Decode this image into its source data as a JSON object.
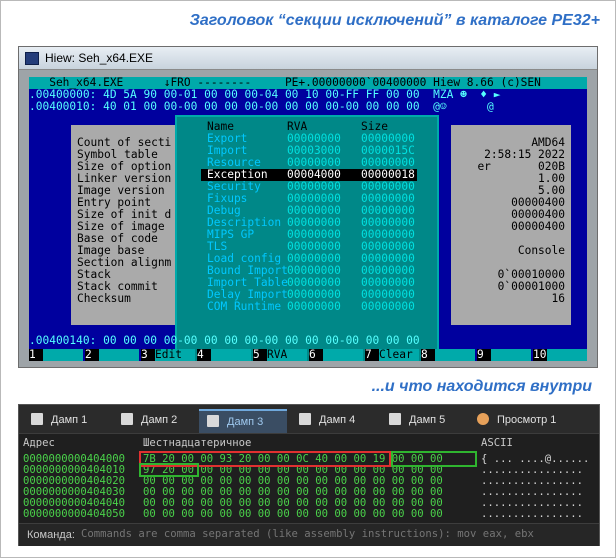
{
  "captions": {
    "top": "Заголовок “секции исключений” в каталоге PE32+",
    "bottom": "...и что находится внутри"
  },
  "hiew": {
    "window_title": "Hiew: Seh_x64.EXE",
    "status_line": "   Seh_x64.EXE      ↓FRO --------     PE+.00000000`00400000 Hiew 8.66 (c)SEN",
    "line1": ".00400000: 4D 5A 90 00-01 00 00 00-04 00 10 00-FF FF 00 00  MZA ☻  ♦ ►",
    "line2": ".00400010: 40 01 00 00-00 00 00 00-00 00 00 00-00 00 00 00  @☺      @",
    "bottom_line": ".00400140: 00 00 00 00-00 00 00 00-00 00 00 00-00 00 00 00",
    "info_labels": [
      "Count of secti",
      "Symbol table",
      "Size of option",
      "Linker version",
      "Image version",
      "Entry point",
      "Size of init d",
      "Size of image",
      "Base of code",
      "Image base",
      "Section alignm",
      "Stack",
      "Stack commit",
      "Checksum"
    ],
    "info_values": [
      "AMD64",
      "2:58:15 2022",
      "er       020B",
      "1.00",
      "5.00",
      "00000400",
      "00000400",
      "00000400",
      "",
      "Console",
      "",
      "0`00010000",
      "0`00001000",
      "16"
    ],
    "dir_header": {
      "name": "Name",
      "rva": "RVA",
      "size": "Size"
    },
    "dir_rows": [
      {
        "name": "Export",
        "rva": "00000000",
        "size": "00000000"
      },
      {
        "name": "Import",
        "rva": "00003000",
        "size": "0000015C"
      },
      {
        "name": "Resource",
        "rva": "00000000",
        "size": "00000000"
      },
      {
        "name": "Exception",
        "rva": "00004000",
        "size": "00000018"
      },
      {
        "name": "Security",
        "rva": "00000000",
        "size": "00000000"
      },
      {
        "name": "Fixups",
        "rva": "00000000",
        "size": "00000000"
      },
      {
        "name": "Debug",
        "rva": "00000000",
        "size": "00000000"
      },
      {
        "name": "Description",
        "rva": "00000000",
        "size": "00000000"
      },
      {
        "name": "MIPS GP",
        "rva": "00000000",
        "size": "00000000"
      },
      {
        "name": "TLS",
        "rva": "00000000",
        "size": "00000000"
      },
      {
        "name": "Load config",
        "rva": "00000000",
        "size": "00000000"
      },
      {
        "name": "Bound Import",
        "rva": "00000000",
        "size": "00000000"
      },
      {
        "name": "Import Table",
        "rva": "00000000",
        "size": "00000000"
      },
      {
        "name": "Delay Import",
        "rva": "00000000",
        "size": "00000000"
      },
      {
        "name": "COM Runtime",
        "rva": "00000000",
        "size": "00000000"
      }
    ],
    "fkeys": [
      {
        "n": "1",
        "label": ""
      },
      {
        "n": "2",
        "label": ""
      },
      {
        "n": "3",
        "label": "Edit"
      },
      {
        "n": "4",
        "label": ""
      },
      {
        "n": "5",
        "label": "RVA"
      },
      {
        "n": "6",
        "label": ""
      },
      {
        "n": "7",
        "label": "Clear"
      },
      {
        "n": "8",
        "label": ""
      },
      {
        "n": "9",
        "label": ""
      },
      {
        "n": "10",
        "label": ""
      }
    ]
  },
  "dump": {
    "tabs": [
      {
        "label": "Дамп 1"
      },
      {
        "label": "Дамп 2"
      },
      {
        "label": "Дамп 3"
      },
      {
        "label": "Дамп 4"
      },
      {
        "label": "Дамп 5"
      },
      {
        "label": "Просмотр 1"
      }
    ],
    "active_tab": 2,
    "col_address": "Адрес",
    "col_hex": "Шестнадцатеричное",
    "col_ascii": "ASCII",
    "rows": [
      {
        "addr": "0000000000404000",
        "hex": "7B 20 00 00 93 20 00 00 0C 40 00 00 19 00 00 00",
        "ascii": "{ ... ....@......"
      },
      {
        "addr": "0000000000404010",
        "hex": "97 20 00 00 00 00 00 00 00 00 00 00 00 00 00 00",
        "ascii": "................"
      },
      {
        "addr": "0000000000404020",
        "hex": "00 00 00 00 00 00 00 00 00 00 00 00 00 00 00 00",
        "ascii": "................"
      },
      {
        "addr": "0000000000404030",
        "hex": "00 00 00 00 00 00 00 00 00 00 00 00 00 00 00 00",
        "ascii": "................"
      },
      {
        "addr": "0000000000404040",
        "hex": "00 00 00 00 00 00 00 00 00 00 00 00 00 00 00 00",
        "ascii": "................"
      },
      {
        "addr": "0000000000404050",
        "hex": "00 00 00 00 00 00 00 00 00 00 00 00 00 00 00 00",
        "ascii": "................"
      }
    ],
    "command_label": "Команда:",
    "command_placeholder": "Commands are comma separated (like assembly instructions): mov eax, ebx"
  },
  "colors": {
    "caption": "#2f6fc6",
    "hex_text": "#4ad24a",
    "highlight_red": "#e03030",
    "highlight_green": "#2fb52f",
    "console_bg": "#00009e"
  },
  "icons": [
    "app-icon",
    "dump-tab-icon",
    "view-tab-icon"
  ]
}
